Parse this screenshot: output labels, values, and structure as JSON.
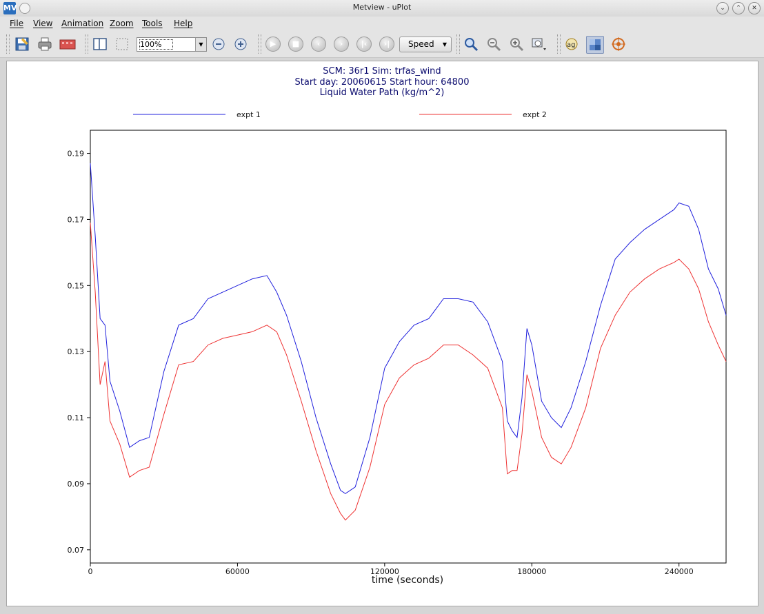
{
  "window": {
    "title": "Metview - uPlot",
    "app_icon": "MV"
  },
  "menubar": {
    "items": [
      "File",
      "View",
      "Animation",
      "Zoom",
      "Tools",
      "Help"
    ]
  },
  "toolbar": {
    "zoom_value": "100%",
    "speed_label": "Speed"
  },
  "plot": {
    "title_lines": [
      "SCM: 36r1  Sim: trfas_wind",
      "Start day: 20060615 Start hour: 64800",
      "Liquid Water Path (kg/m^2)"
    ],
    "legend": [
      "expt 1",
      "expt 2"
    ]
  },
  "chart_data": {
    "type": "line",
    "xlabel": "time (seconds)",
    "ylabel": "",
    "xlim": [
      0,
      259200
    ],
    "ylim": [
      0.066,
      0.197
    ],
    "xticks": [
      0,
      60000,
      120000,
      180000,
      240000
    ],
    "xtick_labels": [
      "0",
      "60000",
      "120000",
      "180000",
      "240000"
    ],
    "yticks": [
      0.07,
      0.09,
      0.11,
      0.13,
      0.15,
      0.17,
      0.19
    ],
    "ytick_labels": [
      "0.07",
      "0.09",
      "0.11",
      "0.13",
      "0.15",
      "0.17",
      "0.19"
    ],
    "series": [
      {
        "name": "expt 1",
        "color": "#2020dd",
        "x": [
          0,
          2000,
          4000,
          6000,
          8000,
          12000,
          16000,
          20000,
          24000,
          30000,
          36000,
          42000,
          48000,
          54000,
          60000,
          66000,
          72000,
          76000,
          80000,
          86000,
          92000,
          98000,
          102000,
          104000,
          108000,
          114000,
          120000,
          126000,
          132000,
          138000,
          144000,
          150000,
          156000,
          162000,
          168000,
          170000,
          172000,
          174000,
          176000,
          178000,
          180000,
          184000,
          188000,
          192000,
          196000,
          202000,
          208000,
          214000,
          220000,
          226000,
          232000,
          238000,
          240000,
          244000,
          248000,
          252000,
          256000,
          259200
        ],
        "y": [
          0.187,
          0.165,
          0.14,
          0.138,
          0.121,
          0.112,
          0.101,
          0.103,
          0.104,
          0.124,
          0.138,
          0.14,
          0.146,
          0.148,
          0.15,
          0.152,
          0.153,
          0.148,
          0.141,
          0.127,
          0.11,
          0.096,
          0.088,
          0.087,
          0.089,
          0.104,
          0.125,
          0.133,
          0.138,
          0.14,
          0.146,
          0.146,
          0.145,
          0.139,
          0.127,
          0.109,
          0.106,
          0.104,
          0.116,
          0.137,
          0.132,
          0.115,
          0.11,
          0.107,
          0.113,
          0.127,
          0.144,
          0.158,
          0.163,
          0.167,
          0.17,
          0.173,
          0.175,
          0.174,
          0.167,
          0.155,
          0.149,
          0.141
        ]
      },
      {
        "name": "expt 2",
        "color": "#ee3333",
        "x": [
          0,
          2000,
          4000,
          6000,
          8000,
          12000,
          16000,
          20000,
          24000,
          30000,
          36000,
          42000,
          48000,
          54000,
          60000,
          66000,
          72000,
          76000,
          80000,
          86000,
          92000,
          98000,
          102000,
          104000,
          108000,
          114000,
          120000,
          126000,
          132000,
          138000,
          144000,
          150000,
          156000,
          162000,
          168000,
          170000,
          172000,
          174000,
          176000,
          178000,
          180000,
          184000,
          188000,
          192000,
          196000,
          202000,
          208000,
          214000,
          220000,
          226000,
          232000,
          238000,
          240000,
          244000,
          248000,
          252000,
          256000,
          259200
        ],
        "y": [
          0.169,
          0.148,
          0.12,
          0.127,
          0.109,
          0.102,
          0.092,
          0.094,
          0.095,
          0.111,
          0.126,
          0.127,
          0.132,
          0.134,
          0.135,
          0.136,
          0.138,
          0.136,
          0.129,
          0.115,
          0.1,
          0.087,
          0.081,
          0.079,
          0.082,
          0.095,
          0.114,
          0.122,
          0.126,
          0.128,
          0.132,
          0.132,
          0.129,
          0.125,
          0.113,
          0.093,
          0.094,
          0.094,
          0.105,
          0.123,
          0.118,
          0.104,
          0.098,
          0.096,
          0.101,
          0.113,
          0.131,
          0.141,
          0.148,
          0.152,
          0.155,
          0.157,
          0.158,
          0.155,
          0.149,
          0.139,
          0.132,
          0.127
        ]
      }
    ]
  }
}
